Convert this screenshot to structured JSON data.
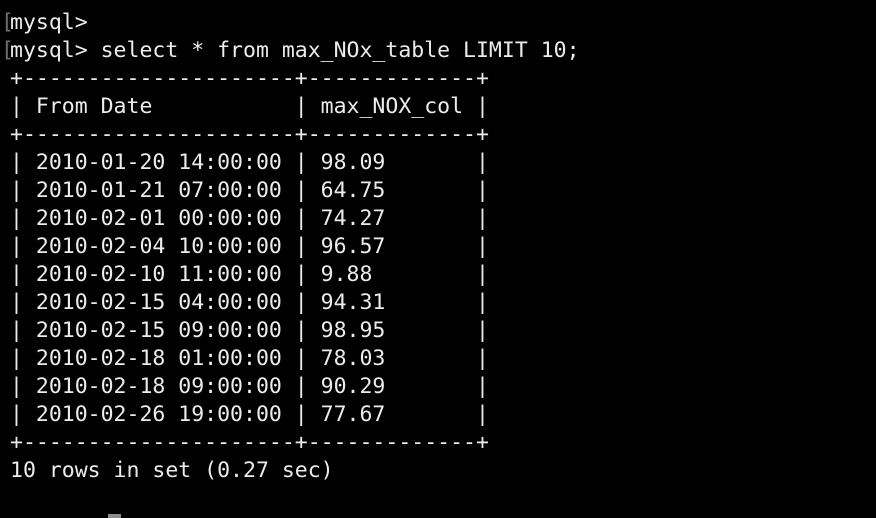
{
  "terminal": {
    "prompt_line_1": "mysql>",
    "prompt_line_2": "mysql> select * from max_NOx_table LIMIT 10;",
    "border_line": "+---------------------+-------------+",
    "header_row": "| From Date           | max_NOX_col |",
    "columns": [
      "From Date",
      "max_NOX_col"
    ],
    "rows": [
      "| 2010-01-20 14:00:00 | 98.09       |",
      "| 2010-01-21 07:00:00 | 64.75       |",
      "| 2010-02-01 00:00:00 | 74.27       |",
      "| 2010-02-04 10:00:00 | 96.57       |",
      "| 2010-02-10 11:00:00 | 9.88        |",
      "| 2010-02-15 04:00:00 | 94.31       |",
      "| 2010-02-15 09:00:00 | 98.95       |",
      "| 2010-02-18 01:00:00 | 78.03       |",
      "| 2010-02-18 09:00:00 | 90.29       |",
      "| 2010-02-26 19:00:00 | 77.67       |"
    ],
    "result_summary": "10 rows in set (0.27 sec)",
    "line_marker": "[",
    "colors": {
      "background": "#000000",
      "text": "#ececec",
      "marker": "#6d6d6d",
      "cursor": "#8c8c8c"
    }
  }
}
